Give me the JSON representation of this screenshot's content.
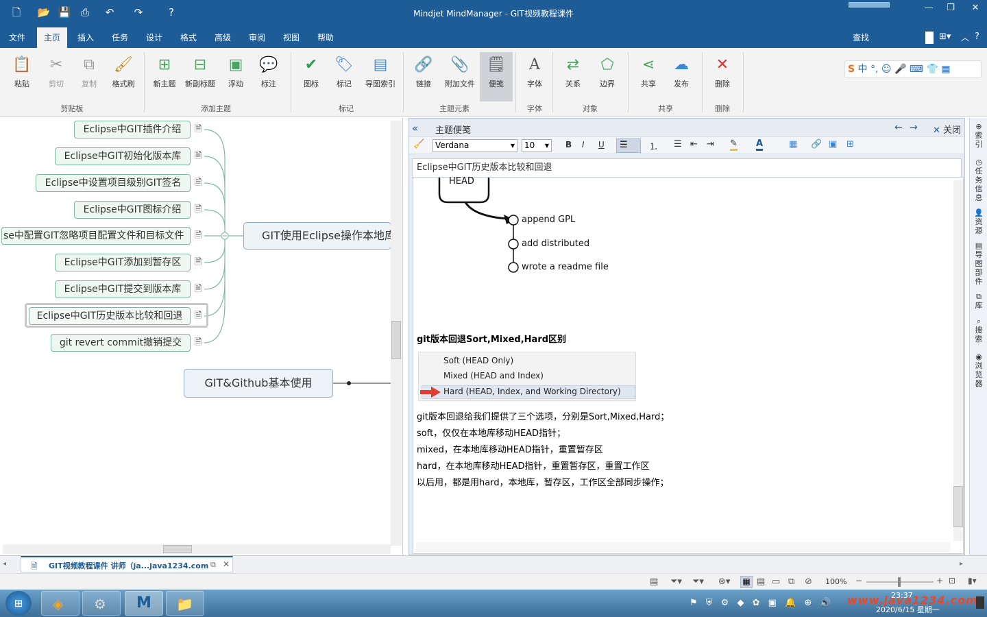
{
  "app": {
    "title": "Mindjet MindManager - GIT视频教程课件"
  },
  "menu": {
    "tabs": [
      "文件",
      "主页",
      "插入",
      "任务",
      "设计",
      "格式",
      "高级",
      "审阅",
      "视图",
      "帮助"
    ],
    "active": "主页",
    "search_label": "查找"
  },
  "ribbon": {
    "buttons": {
      "paste": "粘贴",
      "cut": "剪切",
      "copy": "复制",
      "format_painter": "格式刷",
      "new_topic": "新主题",
      "new_subtopic": "新副标题",
      "float": "浮动",
      "callout": "标注",
      "icons": "图标",
      "tags": "标记",
      "map_index": "导图索引",
      "link": "链接",
      "attachment": "附加文件",
      "note": "便笺",
      "font": "字体",
      "relationship": "关系",
      "boundary": "边界",
      "share": "共享",
      "publish": "发布",
      "delete": "删除"
    },
    "groups": {
      "clipboard": "剪贴板",
      "add_topic": "添加主题",
      "markers": "标记",
      "topic_elements": "主题元素",
      "font": "字体",
      "objects": "对象",
      "share": "共享",
      "delete": "删除"
    }
  },
  "mindmap": {
    "subtopics": [
      "Eclipse中GIT插件介绍",
      "Eclipse中GIT初始化版本库",
      "Eclipse中设置项目级别GIT签名",
      "Eclipse中GIT图标介绍",
      "se中配置GIT忽略项目配置文件和目标文件",
      "Eclipse中GIT添加到暂存区",
      "Eclipse中GIT提交到版本库",
      "Eclipse中GIT历史版本比较和回退",
      "git revert commit撤销提交"
    ],
    "central_topic": "GIT使用Eclipse操作本地库",
    "main_topic": "GIT&Github基本使用"
  },
  "notes": {
    "pane_title": "主题便笺",
    "close_label": "关闭",
    "font_name": "Verdana",
    "font_size": "10",
    "topic_title": "Eclipse中GIT历史版本比较和回退",
    "graph": {
      "head_label": "HEAD",
      "commits": [
        "append GPL",
        "add distributed",
        "wrote a readme file"
      ]
    },
    "heading": "git版本回退Sort,Mixed,Hard区别",
    "options": [
      "Soft (HEAD Only)",
      "Mixed (HEAD and Index)",
      "Hard (HEAD, Index, and Working Directory)"
    ],
    "selected_option": 2,
    "paragraphs": [
      "git版本回退给我们提供了三个选项，分别是Sort,Mixed,Hard；",
      "soft，仅仅在本地库移动HEAD指针；",
      "mixed，在本地库移动HEAD指针，重置暂存区",
      "hard，在本地库移动HEAD指针，重置暂存区，重置工作区",
      "以后用，都是用hard，本地库，暂存区，工作区全部同步操作；"
    ]
  },
  "sidebar": {
    "items": [
      "索引",
      "任务信息",
      "资源",
      "导图部件",
      "库",
      "搜索",
      "浏览器"
    ]
  },
  "doc_tab": {
    "label": "GIT视频教程课件 讲师（ja...java1234.com"
  },
  "status": {
    "zoom": "100%"
  },
  "taskbar": {
    "time": "23:37",
    "date": "2020/6/15 星期一",
    "watermark": "www.java1234.com"
  },
  "colors": {
    "titlebar": "#1e5c97",
    "node_border": "#7fb7a1",
    "node_fill": "#eef7f1",
    "arrow_red": "#e03c31"
  }
}
